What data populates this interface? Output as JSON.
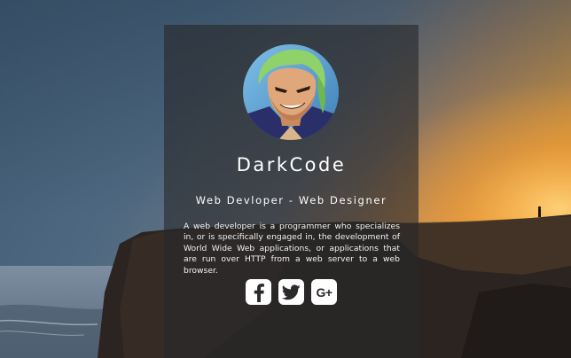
{
  "profile": {
    "name": "DarkCode",
    "title": "Web Devloper - Web Designer",
    "bio": "A web developer is a programmer who specializes in, or is specifically engaged in, the development of World Wide Web applications, or applications that are run over HTTP from a web server to a web browser."
  },
  "social": {
    "links": [
      {
        "icon": "facebook-icon"
      },
      {
        "icon": "twitter-icon"
      },
      {
        "icon": "google-plus-icon",
        "glyph": "G+"
      }
    ]
  },
  "colors": {
    "card_bg": "#28282a",
    "text": "#ffffff",
    "icon_bg": "#ffffff",
    "icon_fg": "#2a2a2c"
  }
}
